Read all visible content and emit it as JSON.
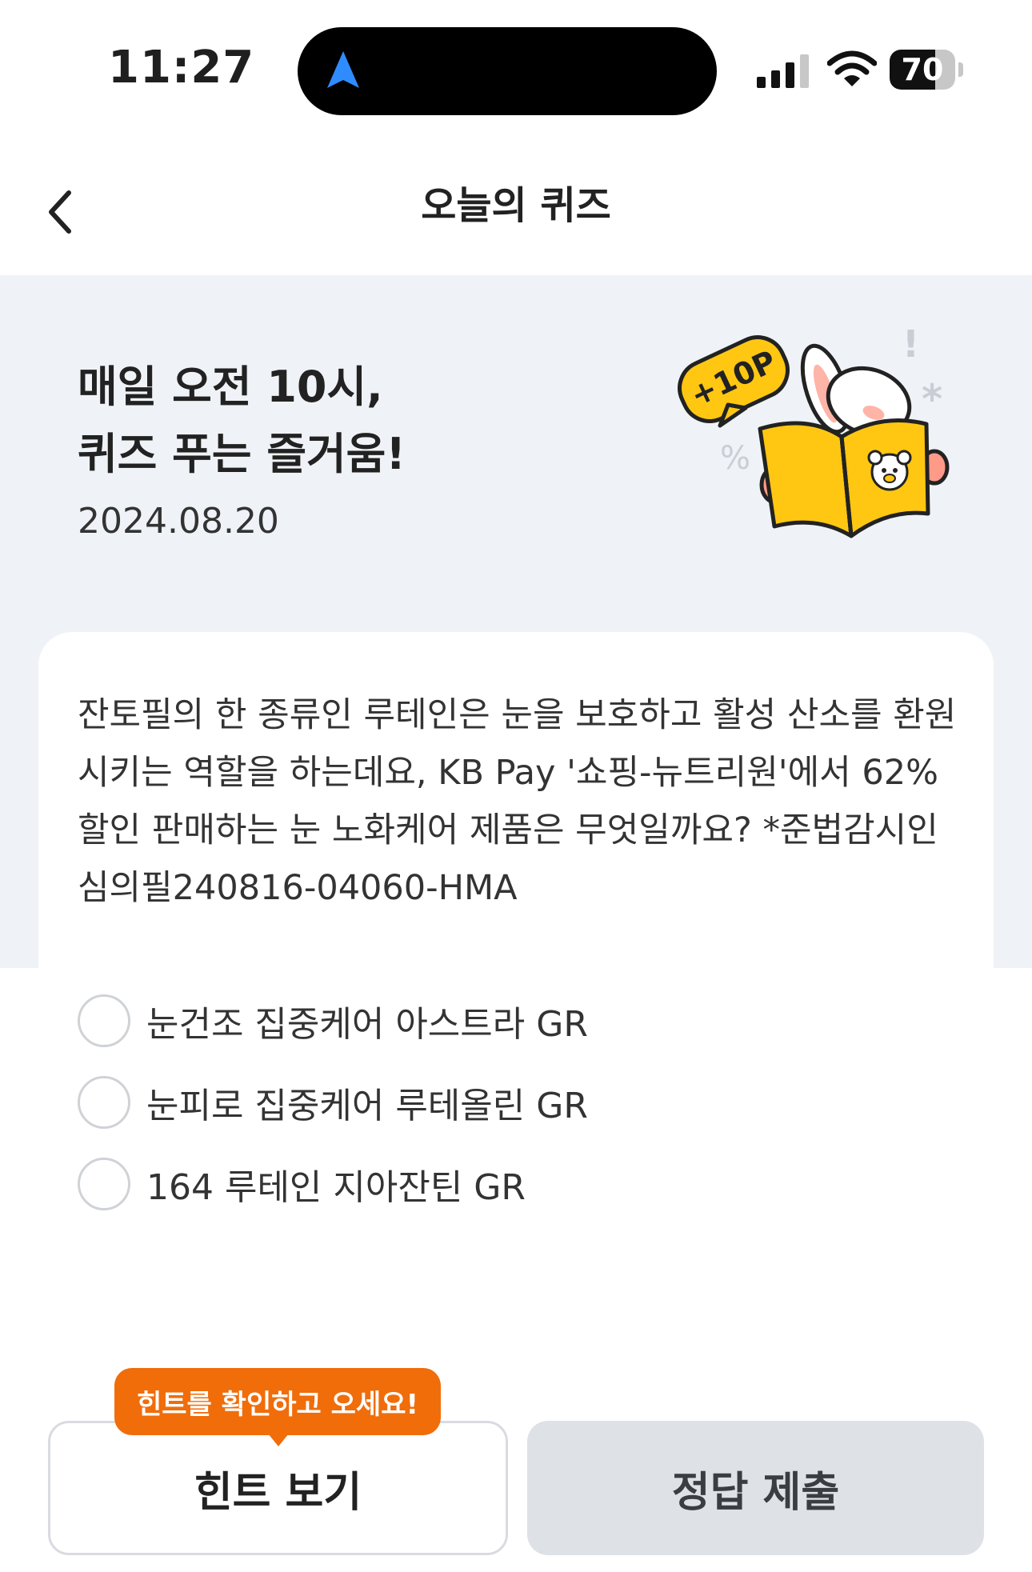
{
  "status_bar": {
    "time": "11:27",
    "battery": "70",
    "battery_level": 0.7,
    "navigation_icon": "location-arrow-icon"
  },
  "header": {
    "title": "오늘의 퀴즈",
    "back_icon": "chevron-left-icon"
  },
  "hero": {
    "title": "매일 오전 10시,\n퀴즈 푸는 즐거움!",
    "date": "2024.08.20",
    "badge": "+10P",
    "illustration": "rabbit-reading-book-illustration"
  },
  "question": {
    "text": "잔토필의 한 종류인 루테인은 눈을 보호하고 활성 산소를 환원시키는 역할을 하는데요, KB Pay '쇼핑-뉴트리원'에서 62% 할인 판매하는 눈 노화케어 제품은 무엇일까요? *준법감시인심의필240816-04060-HMA"
  },
  "options": [
    {
      "label": "눈건조 집중케어 아스트라 GR"
    },
    {
      "label": "눈피로 집중케어 루테올린 GR"
    },
    {
      "label": "164 루테인 지아잔틴 GR"
    }
  ],
  "actions": {
    "hint_tooltip": "힌트를 확인하고 오세요!",
    "hint_label": "힌트 보기",
    "submit_label": "정답 제출"
  },
  "colors": {
    "hero_background": "#eff2f6",
    "tooltip": "#f06d0a",
    "submit_button": "#dee1e6",
    "accent_yellow": "#ffc711"
  }
}
